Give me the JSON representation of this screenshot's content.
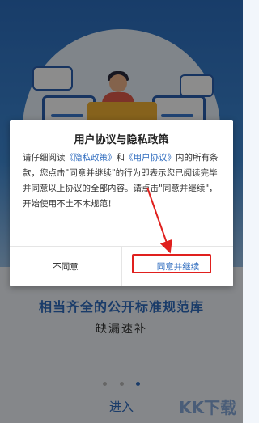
{
  "lower": {
    "title": "相当齐全的公开标准规范库",
    "subtitle": "缺漏速补",
    "enter_label": "进入",
    "watermark": "KK下载"
  },
  "dialog": {
    "title": "用户协议与隐私政策",
    "text_1": "请仔细阅读",
    "privacy_link": "《隐私政策》",
    "text_and": "和",
    "agreement_link": "《用户协议》",
    "text_2": "内的所有条款，您点击\"同意并继续\"的行为即表示您已阅读完毕并同意以上协议的全部内容。请点击\"同意并继续\"，开始使用不土不木规范！",
    "disagree_label": "不同意",
    "agree_label": "同意并继续"
  },
  "colors": {
    "accent": "#2f6cbf",
    "highlight": "#e0201e",
    "hero_top": "#2d6fc0"
  },
  "pagination": {
    "total": 3,
    "active": 3
  }
}
